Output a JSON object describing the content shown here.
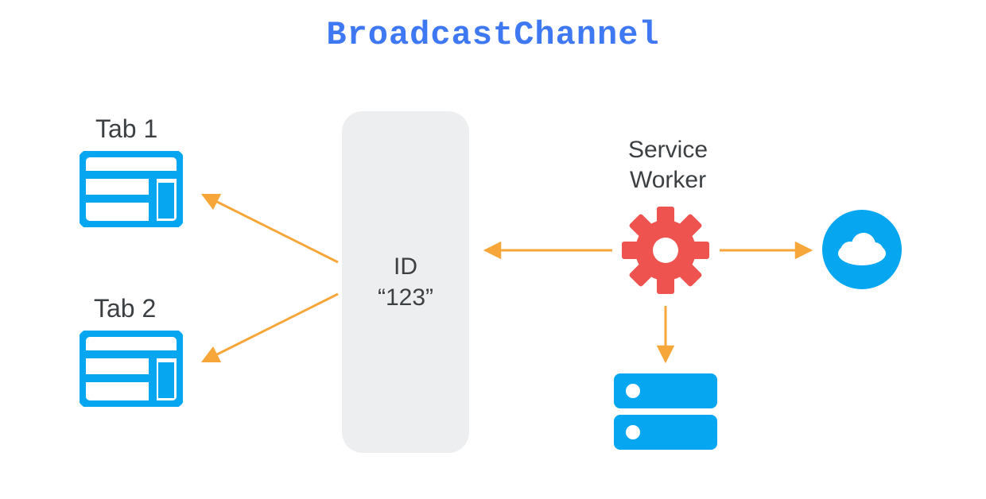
{
  "title": "BroadcastChannel",
  "tabs": [
    {
      "label": "Tab 1"
    },
    {
      "label": "Tab 2"
    }
  ],
  "channel": {
    "line1": "ID",
    "line2": "“123”"
  },
  "serviceWorker": {
    "line1": "Service",
    "line2": "Worker"
  },
  "icons": {
    "tab": "window-icon",
    "gear": "gear-icon",
    "cloud": "cloud-icon",
    "server": "server-icon"
  },
  "colors": {
    "title": "#3e78f3",
    "accentBlue": "#06a6f1",
    "accentRed": "#ef5350",
    "arrow": "#f7a63a",
    "channelBg": "#eceeef",
    "text": "#3c4043"
  }
}
